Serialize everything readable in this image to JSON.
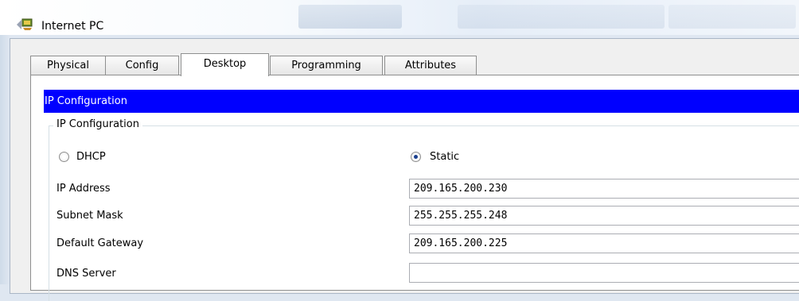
{
  "window": {
    "title": "Internet PC"
  },
  "tabs": [
    {
      "label": "Physical",
      "active": false
    },
    {
      "label": "Config",
      "active": false
    },
    {
      "label": "Desktop",
      "active": true
    },
    {
      "label": "Programming",
      "active": false
    },
    {
      "label": "Attributes",
      "active": false
    }
  ],
  "header": {
    "title": "IP Configuration"
  },
  "group": {
    "legend": "IP Configuration"
  },
  "mode": {
    "dhcp_label": "DHCP",
    "static_label": "Static",
    "selected": "Static"
  },
  "fields": [
    {
      "label": "IP Address",
      "value": "209.165.200.230"
    },
    {
      "label": "Subnet Mask",
      "value": "255.255.255.248"
    },
    {
      "label": "Default Gateway",
      "value": "209.165.200.225"
    },
    {
      "label": "DNS Server",
      "value": ""
    }
  ],
  "icons": {
    "app": "packet-tracer-pc-icon",
    "radio_selected": "radio-selected-icon",
    "radio_empty": "radio-empty-icon"
  },
  "colors": {
    "header_bg": "#0000ff",
    "header_text": "#ffffff"
  }
}
